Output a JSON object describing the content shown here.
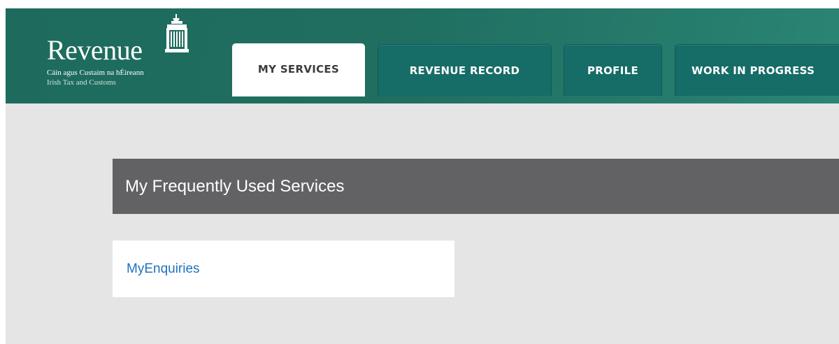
{
  "header": {
    "logo": {
      "title": "Revenue",
      "irish_subtitle": "Cáin agus Custaim na hÉireann",
      "english_subtitle": "Irish Tax and Customs",
      "emblem_icon": "harp-emblem-icon"
    },
    "tabs": [
      {
        "label": "MY SERVICES",
        "active": true
      },
      {
        "label": "REVENUE RECORD",
        "active": false
      },
      {
        "label": "PROFILE",
        "active": false
      },
      {
        "label": "WORK IN PROGRESS",
        "active": false
      }
    ]
  },
  "main": {
    "section_title": "My Frequently Used Services",
    "services": [
      {
        "label": "MyEnquiries"
      }
    ]
  },
  "colors": {
    "header_green": "#1f6e60",
    "tab_teal": "#166c66",
    "section_bar": "#626264",
    "content_bg": "#e5e5e5",
    "link_blue": "#1f72bd"
  }
}
